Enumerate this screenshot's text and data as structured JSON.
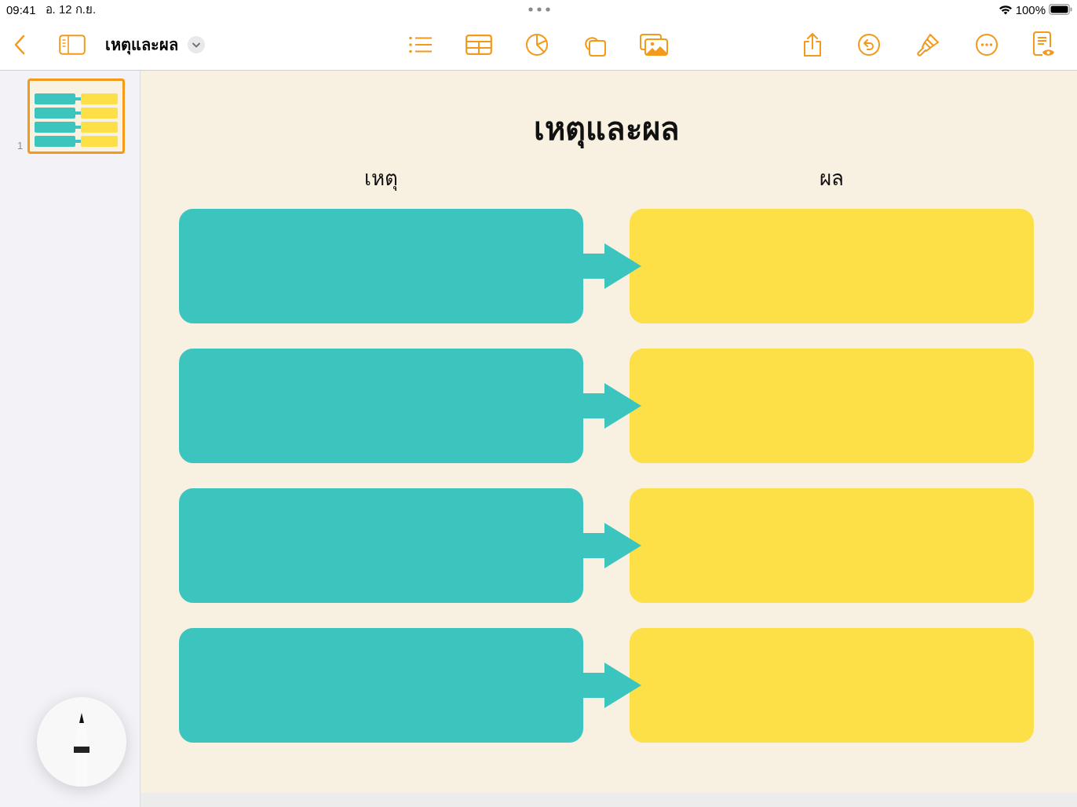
{
  "status_bar": {
    "time": "09:41",
    "date": "อ. 12 ก.ย.",
    "battery": "100%"
  },
  "toolbar": {
    "document_title": "เหตุและผล"
  },
  "sidebar": {
    "slides": [
      {
        "number": "1",
        "selected": true
      }
    ]
  },
  "slide": {
    "title": "เหตุและผล",
    "column_headings": [
      "เหตุ",
      "ผล"
    ],
    "rows": [
      {
        "kind": "arrow"
      },
      {
        "kind": "arrow"
      },
      {
        "kind": "arrow"
      },
      {
        "kind": "arrow"
      }
    ]
  }
}
